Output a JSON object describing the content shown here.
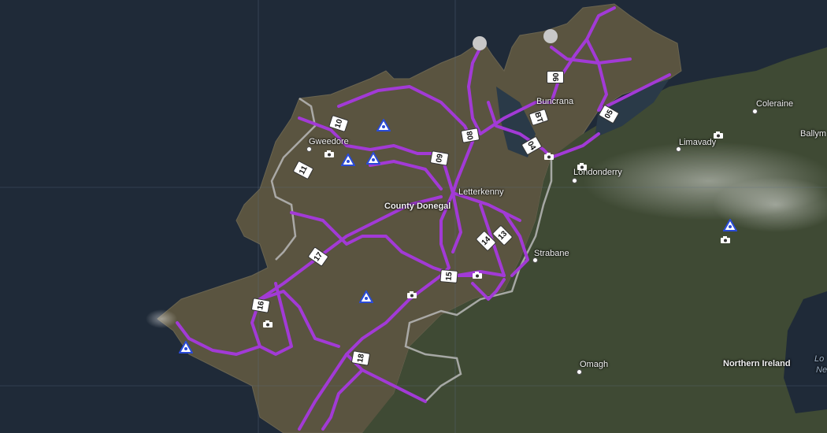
{
  "map": {
    "base": "satellite",
    "colors": {
      "sea": "#1f2a38",
      "land": "#4a5238",
      "route": "#a23ad6",
      "border": "#b8b8b8",
      "grid": "#5f7086",
      "marker_stroke": "#2a4bd8"
    },
    "places": [
      {
        "key": "gweedore",
        "name": "Gweedore"
      },
      {
        "key": "buncrana",
        "name": "Buncrana"
      },
      {
        "key": "coleraine",
        "name": "Coleraine"
      },
      {
        "key": "ballymoney",
        "name": "Ballym"
      },
      {
        "key": "limavady",
        "name": "Limavady"
      },
      {
        "key": "londonderry",
        "name": "Londonderry"
      },
      {
        "key": "letterkenny",
        "name": "Letterkenny"
      },
      {
        "key": "county_donegal",
        "name": "County Donegal"
      },
      {
        "key": "strabane",
        "name": "Strabane"
      },
      {
        "key": "omagh",
        "name": "Omagh"
      },
      {
        "key": "northern_ireland",
        "name": "Northern Ireland"
      },
      {
        "key": "lough",
        "name": "Lo"
      },
      {
        "key": "lough2",
        "name": "Ne"
      }
    ],
    "route_labels": [
      "10",
      "11",
      "09",
      "08",
      "06",
      "BT",
      "04",
      "05",
      "17",
      "14",
      "13",
      "15",
      "16",
      "18"
    ],
    "markers": {
      "triangle_icon": "triangle-warning-icon",
      "camera_icon": "camera-icon"
    }
  }
}
